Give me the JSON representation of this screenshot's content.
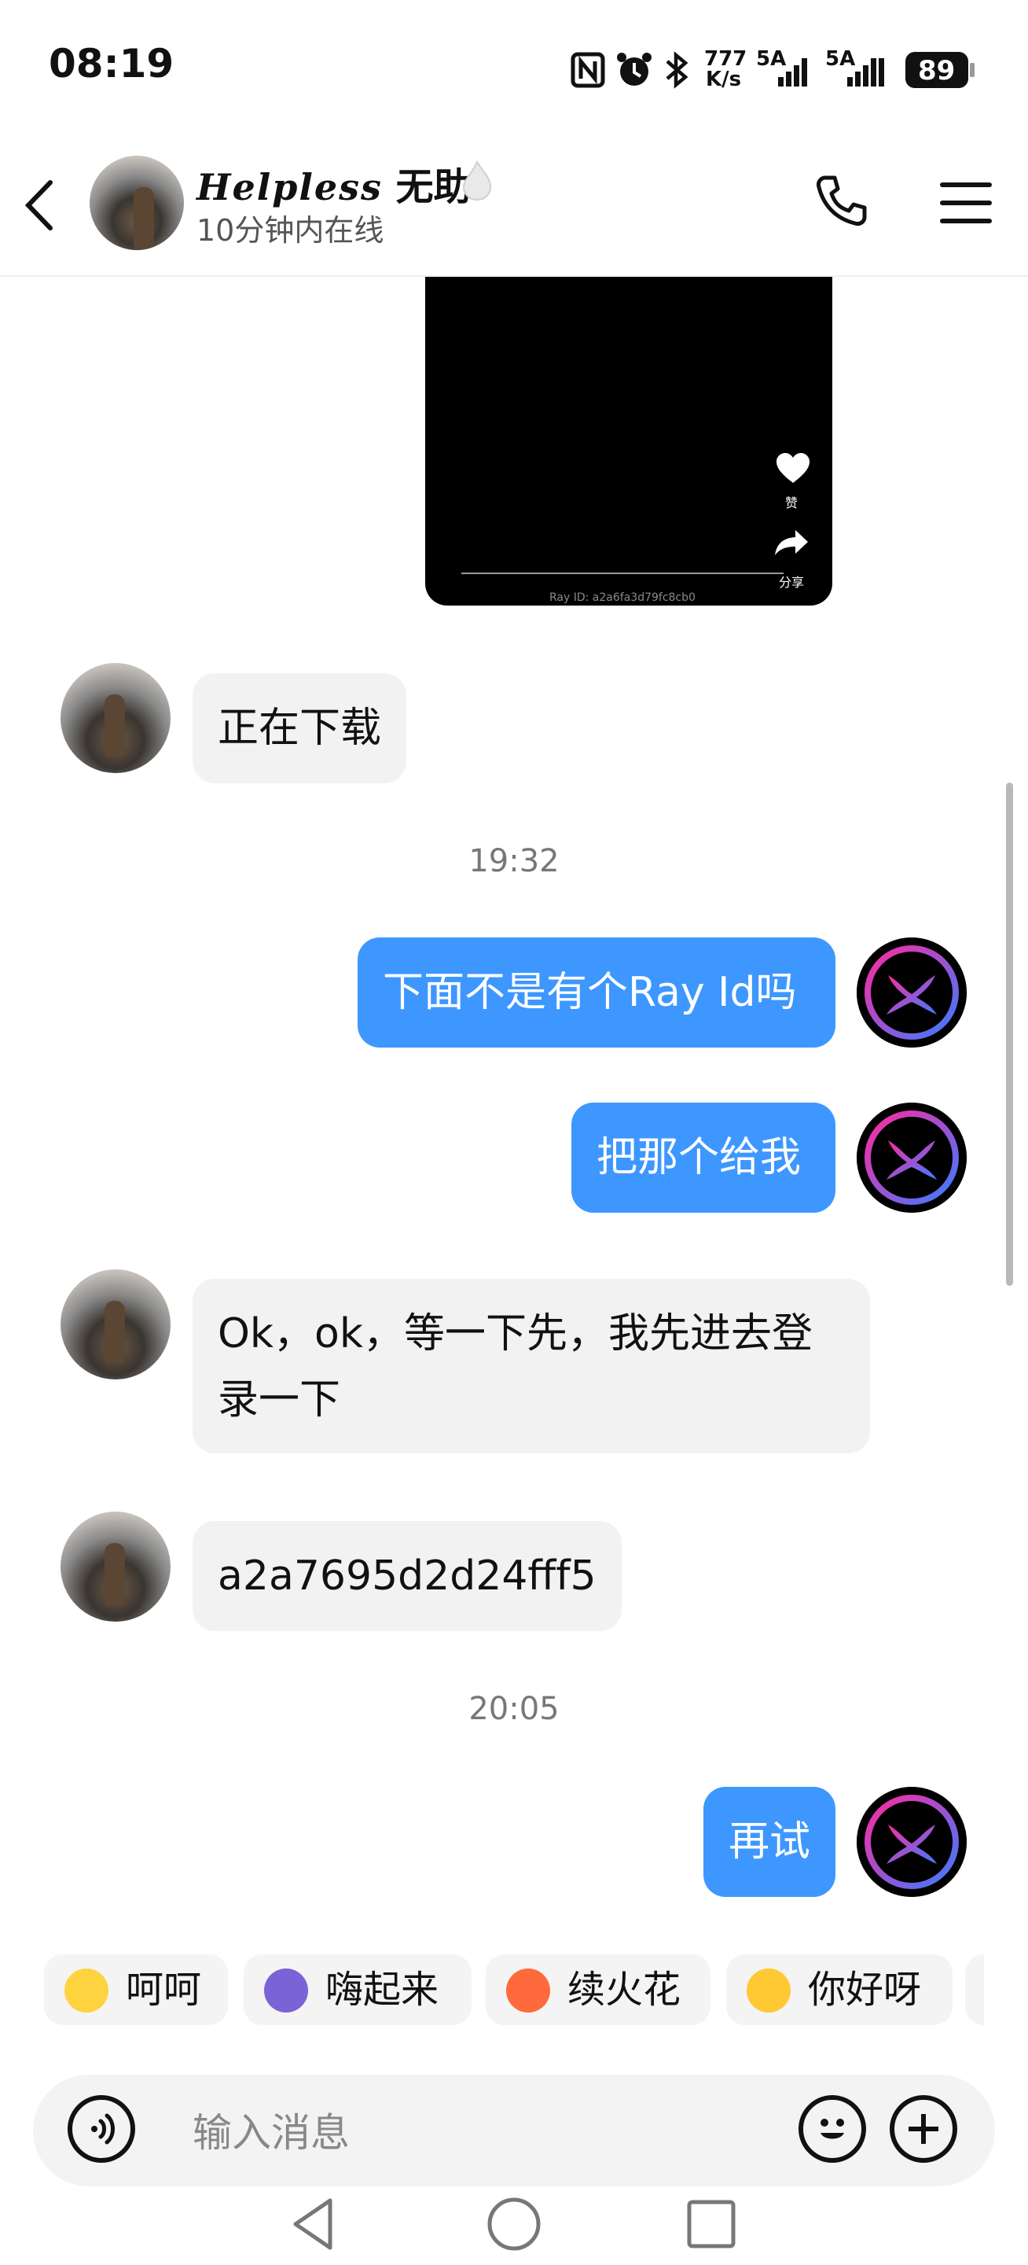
{
  "status_bar": {
    "time": "08:19",
    "net_speed_top": "777",
    "net_speed_bottom": "K/s",
    "signal1_label": "5A",
    "signal2_label": "5A",
    "battery": "89"
  },
  "header": {
    "name_script": "Helpless",
    "name_cn": "无助",
    "status": "10分钟内在线",
    "icons": [
      "back-arrow-icon",
      "phone-icon",
      "menu-icon",
      "fire-icon"
    ]
  },
  "video_card": {
    "like_label": "赞",
    "share_label": "分享",
    "ray_id": "Ray ID: a2a6fa3d79fc8cb0"
  },
  "messages": [
    {
      "side": "in",
      "text": "正在下载"
    },
    {
      "type": "time",
      "text": "19:32"
    },
    {
      "side": "out",
      "text": "下面不是有个Ray Id吗"
    },
    {
      "side": "out",
      "text": "把那个给我"
    },
    {
      "side": "in",
      "text_line1": "Ok，ok，等一下先，我先进去登",
      "text_line2": "录一下"
    },
    {
      "side": "in",
      "text": "a2a7695d2d24fff5"
    },
    {
      "type": "time",
      "text": "20:05"
    },
    {
      "side": "out",
      "text": "再试"
    }
  ],
  "quick_replies": [
    "呵呵",
    "嗨起来",
    "续火花",
    "你好呀"
  ],
  "input": {
    "placeholder": "输入消息",
    "icons": [
      "voice-icon",
      "emoji-icon",
      "plus-icon"
    ]
  },
  "colors": {
    "out_bubble": "#3d97ff",
    "in_bubble": "#f2f2f2"
  }
}
